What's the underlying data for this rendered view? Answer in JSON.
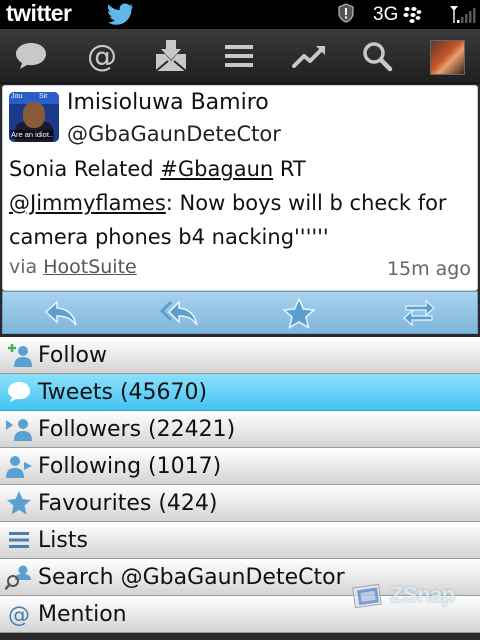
{
  "statusbar": {
    "app_logo_text": "twitter",
    "network": "3G",
    "icons": [
      "twitter-bird-icon",
      "alert-shield-icon",
      "blackberry-icon",
      "signal-icon"
    ]
  },
  "toolbar": {
    "buttons": [
      "messages-icon",
      "mentions-icon",
      "inbox-icon",
      "menu-lines-icon",
      "trends-icon",
      "search-icon",
      "profile-avatar"
    ]
  },
  "tweet": {
    "name": "Imisioluwa Bamiro",
    "handle": "@GbaGaunDeteCtor",
    "text_prefix": "Sonia Related ",
    "hashtag": "#Gbagaun",
    "text_mid": " RT ",
    "mention": "@Jimmyflames",
    "text_suffix": ": Now boys will b check for camera phones b4 nacking''''''",
    "via_label": "via ",
    "source": "HootSuite",
    "time": "15m ago",
    "avatar_text_top_left": "Jou",
    "avatar_text_top_right": "Sir",
    "avatar_text_bottom": "Are an idiot.."
  },
  "actions": [
    "reply-icon",
    "reply-all-icon",
    "favorite-star-icon",
    "retweet-icon"
  ],
  "menu": {
    "items": [
      {
        "label": "Follow",
        "icon": "add-user-icon"
      },
      {
        "label": "Tweets (45670)",
        "icon": "speech-bubble-icon",
        "selected": true
      },
      {
        "label": "Followers (22421)",
        "icon": "followers-icon"
      },
      {
        "label": "Following (1017)",
        "icon": "following-icon"
      },
      {
        "label": "Favourites (424)",
        "icon": "star-icon"
      },
      {
        "label": "Lists",
        "icon": "list-icon"
      },
      {
        "label": "Search @GbaGaunDeteCtor",
        "icon": "search-user-icon"
      },
      {
        "label": "Mention",
        "icon": "at-icon"
      }
    ]
  },
  "watermark": {
    "text": "ZSnap"
  },
  "colors": {
    "selected": "#43c3f2",
    "action_bar": "#8fc2e3",
    "icon_blue": "#5aa0d0"
  }
}
